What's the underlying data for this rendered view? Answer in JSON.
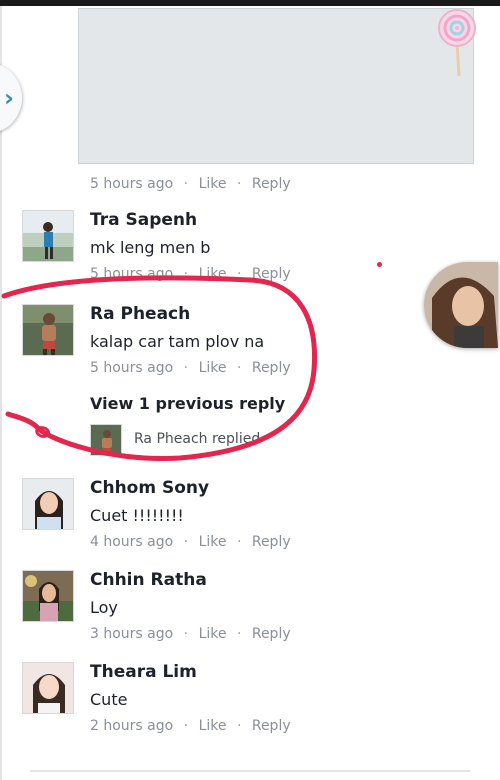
{
  "post": {
    "meta": {
      "time": "5 hours ago",
      "like": "Like",
      "reply": "Reply",
      "separator": "·"
    }
  },
  "comments": [
    {
      "name": "Tra Sapenh",
      "text": "mk leng men b",
      "time": "5 hours ago",
      "like": "Like",
      "reply": "Reply",
      "separator": "·"
    },
    {
      "name": "Ra Pheach",
      "text": "kalap car tam plov na",
      "time": "5 hours ago",
      "like": "Like",
      "reply": "Reply",
      "separator": "·",
      "view_previous": "View 1 previous reply",
      "reply_summary": "Ra Pheach replied"
    },
    {
      "name": "Chhom Sony",
      "text": "Cuet !!!!!!!!",
      "time": "4 hours ago",
      "like": "Like",
      "reply": "Reply",
      "separator": "·"
    },
    {
      "name": "Chhin Ratha",
      "text": "Loy",
      "time": "3 hours ago",
      "like": "Like",
      "reply": "Reply",
      "separator": "·"
    },
    {
      "name": "Theara Lim",
      "text": "Cute",
      "time": "2 hours ago",
      "like": "Like",
      "reply": "Reply",
      "separator": "·"
    }
  ],
  "icons": {
    "back": "chevron-right-icon",
    "sticker": "lollipop-icon",
    "chat_head": "chat-head-avatar"
  },
  "colors": {
    "annotation": "#e2264d",
    "meta_text": "#8a8f98",
    "nav_chevron": "#3a8fa4"
  }
}
